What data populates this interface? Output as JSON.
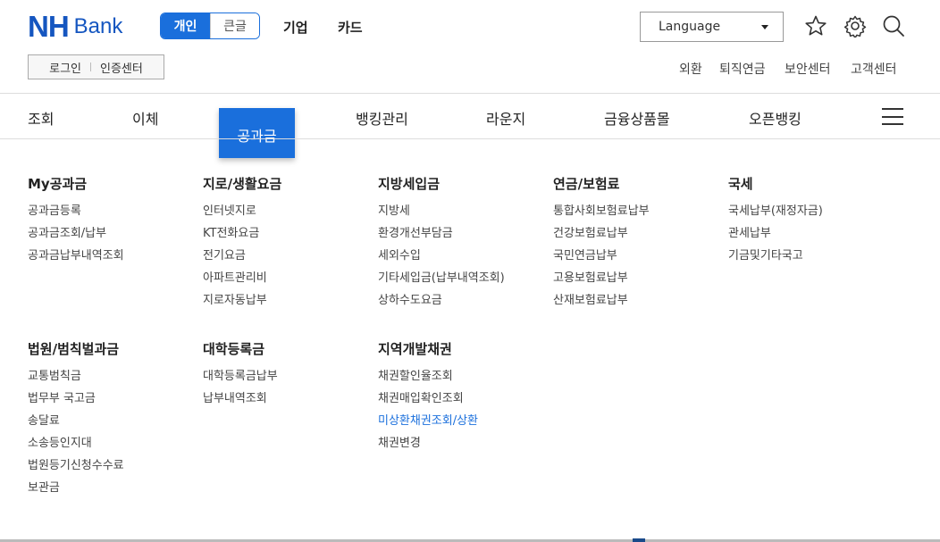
{
  "brand": {
    "nh": "NH",
    "bank": "Bank",
    "color": "#1556c0"
  },
  "segment": {
    "active": "개인",
    "inactive": "큰글"
  },
  "top_links": [
    "기업",
    "카드"
  ],
  "language": {
    "label": "Language"
  },
  "icons": [
    "star-icon",
    "gear-icon",
    "search-icon",
    "hamburger-menu-icon"
  ],
  "login": {
    "login": "로그인",
    "cert": "인증센터"
  },
  "utility_links": [
    "외환",
    "퇴직연금",
    "보안센터",
    "고객센터"
  ],
  "main_nav": {
    "items": [
      "조회",
      "이체",
      "공과금",
      "뱅킹관리",
      "라운지",
      "금융상품몰",
      "오픈뱅킹"
    ],
    "active": "공과금",
    "accent": "#1a6fdc"
  },
  "menu": {
    "row1": [
      {
        "title": "My공과금",
        "items": [
          "공과금등록",
          "공과금조회/납부",
          "공과금납부내역조회"
        ]
      },
      {
        "title": "지로/생활요금",
        "items": [
          "인터넷지로",
          "KT전화요금",
          "전기요금",
          "아파트관리비",
          "지로자동납부"
        ]
      },
      {
        "title": "지방세입금",
        "items": [
          "지방세",
          "환경개선부담금",
          "세외수입",
          "기타세입금(납부내역조회)",
          "상하수도요금"
        ]
      },
      {
        "title": "연금/보험료",
        "items": [
          "통합사회보험료납부",
          "건강보험료납부",
          "국민연금납부",
          "고용보험료납부",
          "산재보험료납부"
        ]
      },
      {
        "title": "국세",
        "items": [
          "국세납부(재정자금)",
          "관세납부",
          "기금및기타국고"
        ]
      }
    ],
    "row2": [
      {
        "title": "법원/범칙벌과금",
        "items": [
          "교통범칙금",
          "법무부 국고금",
          "송달료",
          "소송등인지대",
          "법원등기신청수수료",
          "보관금"
        ]
      },
      {
        "title": "대학등록금",
        "items": [
          "대학등록금납부",
          "납부내역조회"
        ]
      },
      {
        "title": "지역개발채권",
        "items": [
          "채권할인율조회",
          "채권매입확인조회",
          "미상환채권조회/상환",
          "채권변경"
        ]
      }
    ],
    "highlight_item": "미상환채권조회/상환"
  }
}
